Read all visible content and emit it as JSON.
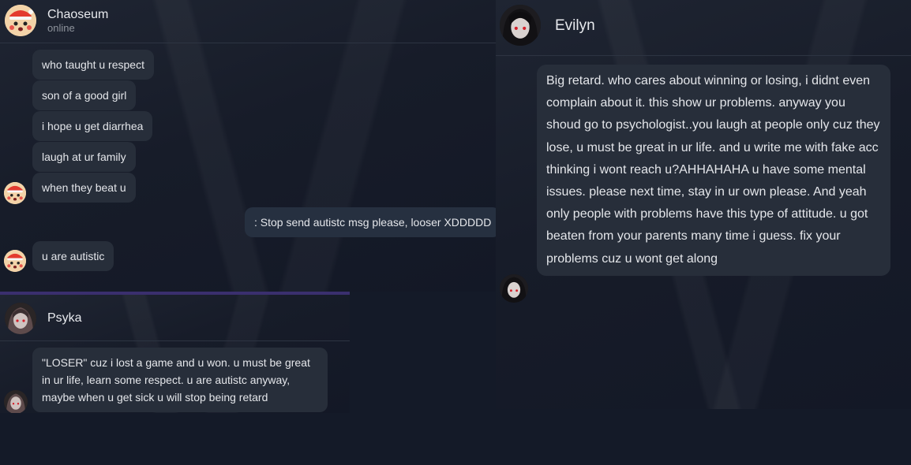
{
  "chaoseum": {
    "name": "Chaoseum",
    "status": "online",
    "messages": [
      "who taught u respect",
      "son of a good girl",
      "i hope u get diarrhea",
      "laugh at ur family",
      "when they beat u"
    ],
    "reply": ": Stop send autistc msg please, looser XDDDDD",
    "last_message": "u are autistic"
  },
  "psyka": {
    "name": "Psyka",
    "message": "\"LOSER\" cuz i lost a game and u won. u must be great in ur life, learn some respect. u are autistc anyway, maybe when u get sick u will stop being retard"
  },
  "evilyn": {
    "name": "Evilyn",
    "message": "Big retard. who cares about winning or losing, i didnt even complain about it. this show ur problems. anyway you shoud go to psychologist..you laugh at people only cuz they lose, u must be great in ur life. and u write me with fake acc thinking i wont reach u?AHHAHAHA u have some mental issues. please next time, stay in ur own please. And yeah only people with problems have this type of attitude. u got beaten from your parents many time i guess. fix your problems cuz u wont get along"
  },
  "colors": {
    "accent": "#3a2f6e",
    "bubble": "#272e3a",
    "background": "#141a28"
  },
  "icons": {
    "chaoseum_avatar": "pikachu-santa-avatar",
    "dark_avatar": "dark-anime-avatar"
  }
}
